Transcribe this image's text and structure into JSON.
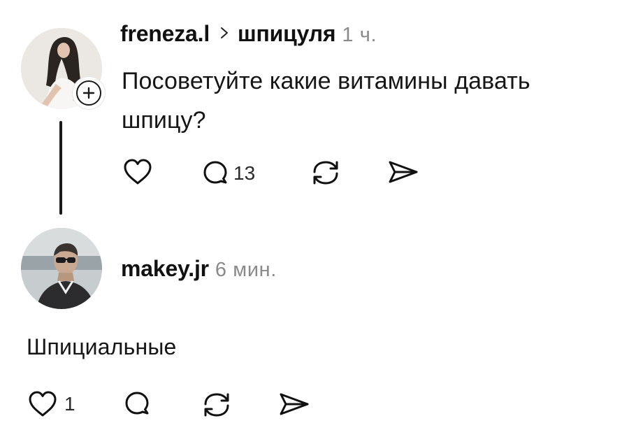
{
  "posts": [
    {
      "username": "freneza.l",
      "topic": "шпицуля",
      "time": "1 ч.",
      "text": "Посоветуйте какие витамины давать шпицу?",
      "actions": {
        "like_icon": "heart-icon",
        "reply_icon": "comment-icon",
        "reply_count": "13",
        "repost_icon": "repost-icon",
        "share_icon": "send-icon"
      }
    },
    {
      "username": "makey.jr",
      "time": "6 мин.",
      "text": "Шпициальные",
      "actions": {
        "like_icon": "heart-icon",
        "like_count": "1",
        "reply_icon": "comment-icon",
        "repost_icon": "repost-icon",
        "share_icon": "send-icon"
      }
    }
  ],
  "follow_badge_icon": "plus-icon",
  "colors": {
    "text": "#111111",
    "muted": "#8a8a8a",
    "background": "#ffffff"
  }
}
